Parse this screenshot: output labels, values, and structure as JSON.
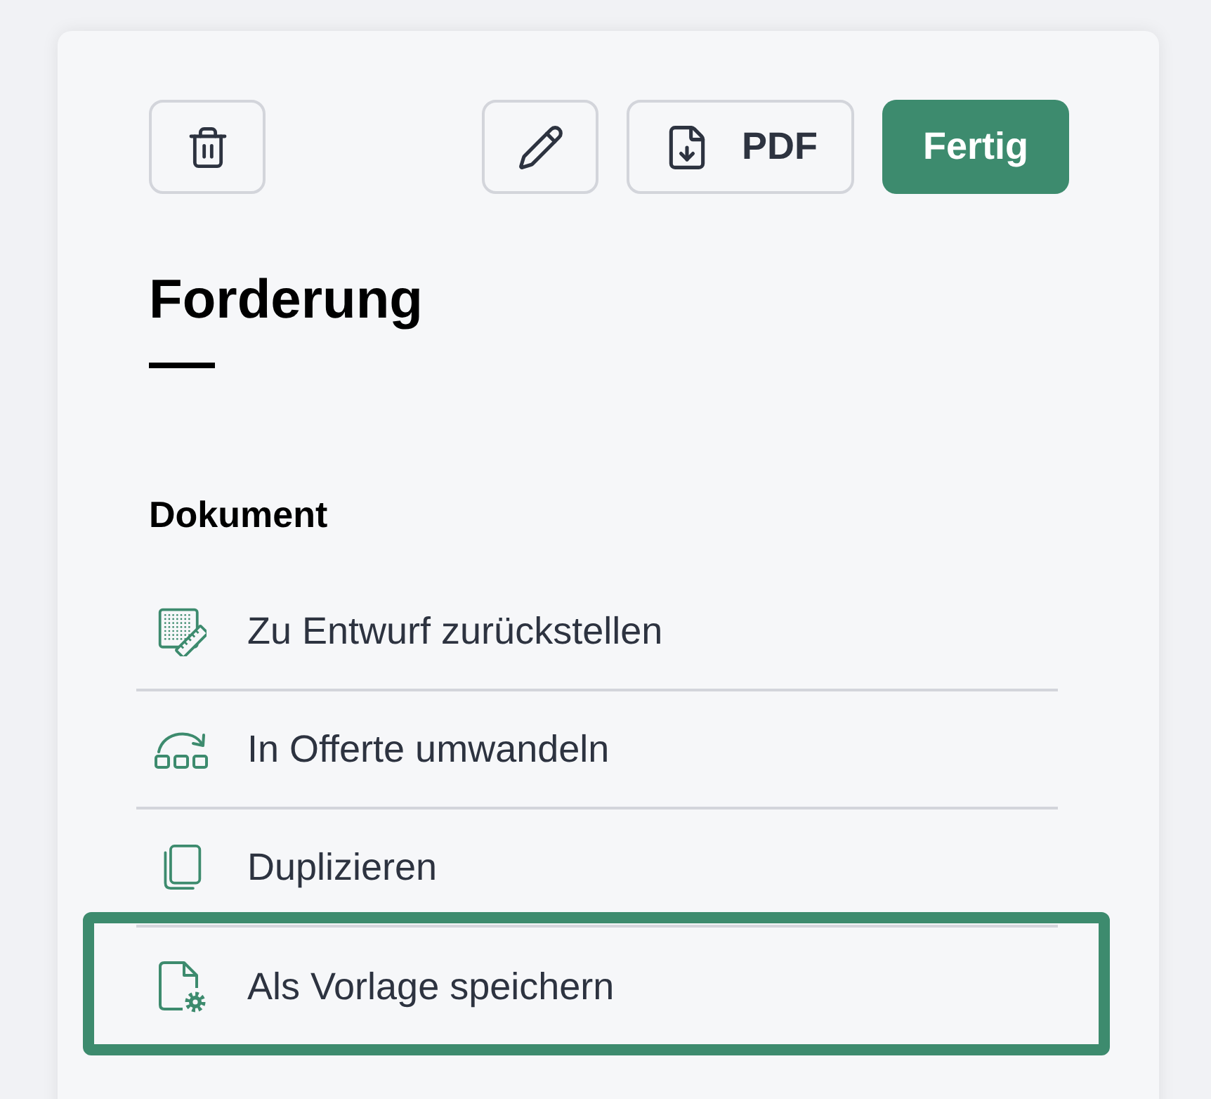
{
  "toolbar": {
    "buttons": [
      {
        "kind": "delete"
      },
      {
        "kind": "edit"
      },
      {
        "kind": "pdf",
        "label": "PDF"
      },
      {
        "kind": "primary",
        "label": "Fertig"
      }
    ]
  },
  "title": "Forderung",
  "section": {
    "heading": "Dokument",
    "items": [
      {
        "kind": "draft",
        "label": "Zu Entwurf zurückstellen",
        "highlighted": false
      },
      {
        "kind": "convert",
        "label": "In Offerte umwandeln",
        "highlighted": false
      },
      {
        "kind": "duplicate",
        "label": "Duplizieren",
        "highlighted": false
      },
      {
        "kind": "template",
        "label": "Als Vorlage speichern",
        "highlighted": true
      }
    ]
  }
}
